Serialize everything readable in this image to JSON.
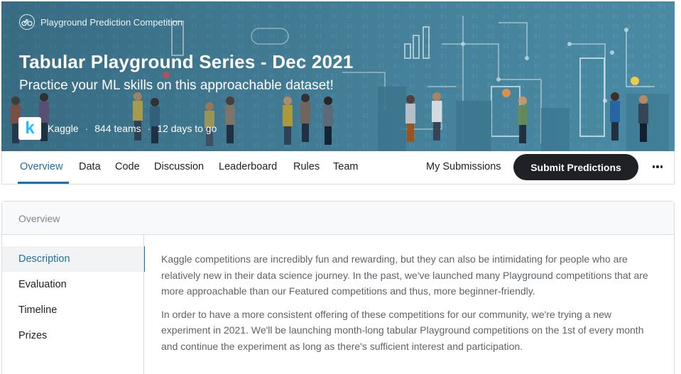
{
  "banner": {
    "tag": "Playground Prediction Competition",
    "title": "Tabular Playground Series - Dec 2021",
    "subtitle": "Practice your ML skills on this approachable dataset!",
    "host": "Kaggle",
    "teams": "844 teams",
    "deadline": "12 days to go",
    "logo_letter": "k",
    "bg_color": "#4a8aa3"
  },
  "tabs": {
    "items": [
      "Overview",
      "Data",
      "Code",
      "Discussion",
      "Leaderboard",
      "Rules",
      "Team"
    ],
    "active": "Overview",
    "my_submissions": "My Submissions",
    "submit": "Submit Predictions"
  },
  "overview": {
    "header": "Overview",
    "side_items": [
      "Description",
      "Evaluation",
      "Timeline",
      "Prizes"
    ],
    "active_item": "Description",
    "paragraphs": [
      "Kaggle competitions are incredibly fun and rewarding, but they can also be intimidating for people who are relatively new in their data science journey. In the past, we've launched many Playground competitions that are more approachable than our Featured competitions and thus, more beginner-friendly.",
      "In order to have a more consistent offering of these competitions for our community, we're trying a new experiment in 2021. We'll be launching month-long tabular Playground competitions on the 1st of every month and continue the experiment as long as there's sufficient interest and participation."
    ]
  },
  "colors": {
    "accent": "#1c6fa8",
    "button_dark": "#202124",
    "kaggle_blue": "#20beff"
  }
}
